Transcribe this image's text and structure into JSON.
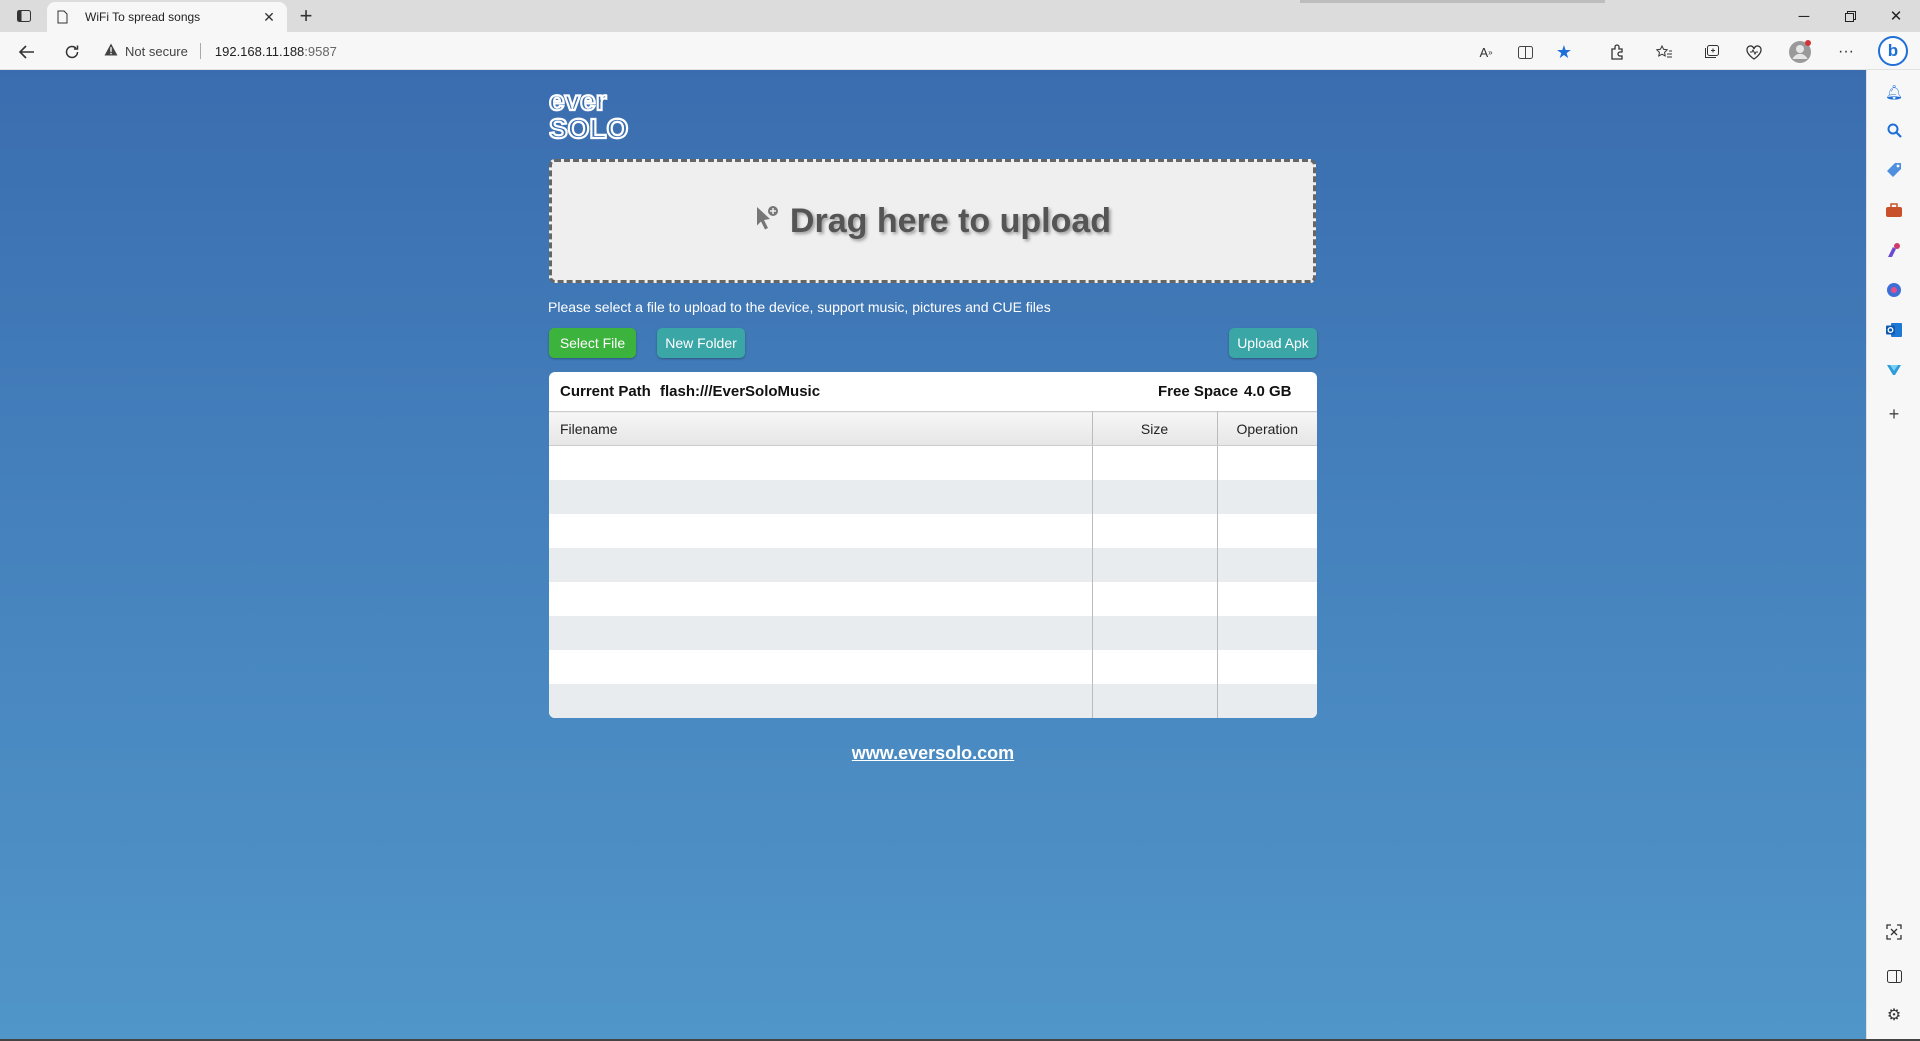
{
  "browser": {
    "tab_title": "WiFi To spread songs",
    "tab_close": "✕",
    "new_tab": "+",
    "security_label": "Not secure",
    "url_host": "192.168.11.188",
    "url_port": ":9587",
    "window_controls": [
      "minimize-icon",
      "restore-icon",
      "close-icon"
    ],
    "toolbar_icons": [
      "read-aloud-icon",
      "split-screen-icon",
      "favorite-star-icon",
      "extensions-icon",
      "favorites-icon",
      "collections-icon",
      "browser-essentials-icon",
      "profile-icon",
      "more-icon"
    ],
    "sidebar_icons": [
      "bell-icon",
      "search-icon",
      "shopping-tag-icon",
      "tools-icon",
      "games-icon",
      "microsoft365-icon",
      "outlook-icon",
      "drop-icon",
      "add-icon"
    ],
    "sidebar_bottom_icons": [
      "screenshot-icon",
      "hide-sidebar-icon",
      "settings-icon"
    ],
    "accent_color": "#1e6fd9"
  },
  "page": {
    "logo_text": [
      "ever",
      "solo"
    ],
    "dropzone_text": "Drag here to upload",
    "hint": "Please select a file to upload to the device, support music, pictures and CUE files",
    "buttons": {
      "select_file": "Select File",
      "new_folder": "New Folder",
      "upload_apk": "Upload Apk"
    },
    "current_path_label": "Current Path",
    "current_path_value": "flash:///EverSoloMusic",
    "free_space_label": "Free Space",
    "free_space_value": "4.0 GB",
    "columns": [
      "Filename",
      "Size",
      "Operation"
    ],
    "rows": [],
    "footer_link": "www.eversolo.com",
    "colors": {
      "background_top": "#3a6daf",
      "background_bottom": "#5196c8",
      "select_button": "#3cb33c",
      "secondary_button": "#3aa6a6"
    }
  }
}
